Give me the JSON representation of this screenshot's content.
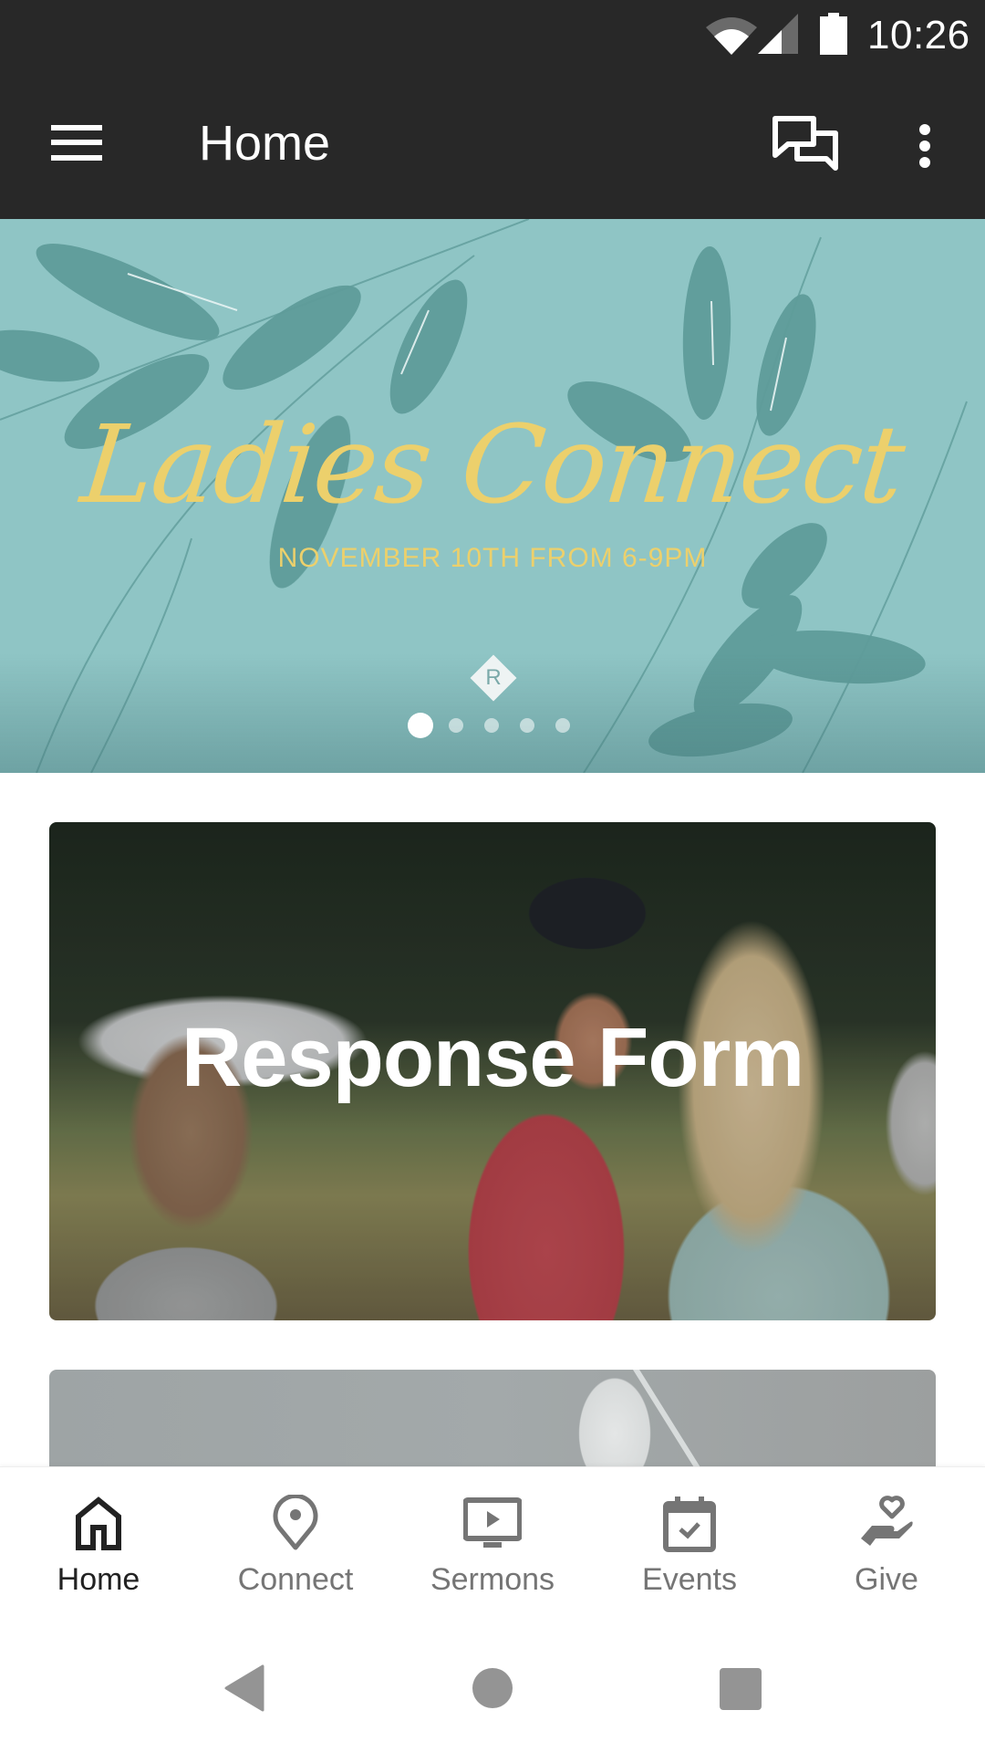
{
  "status_bar": {
    "time": "10:26",
    "icons": [
      "wifi-icon",
      "cell-signal-icon",
      "battery-icon"
    ]
  },
  "app_bar": {
    "title": "Home",
    "left_icon": "menu-icon",
    "right_icons": [
      "chat-icon",
      "more-vert-icon"
    ]
  },
  "banner": {
    "headline": "Ladies Connect",
    "subline": "NOVEMBER 10TH FROM 6-9PM",
    "logo_letter": "R",
    "slide_count": 5,
    "active_slide": 1,
    "colors": {
      "background": "#8fc5c5",
      "leaf": "#5f9c9a",
      "text": "#ecd06c"
    }
  },
  "cards": [
    {
      "title": "Response Form"
    },
    {
      "title": ""
    }
  ],
  "bottom_nav": {
    "items": [
      {
        "label": "Home",
        "icon": "home-icon",
        "active": true
      },
      {
        "label": "Connect",
        "icon": "location-pin-icon",
        "active": false
      },
      {
        "label": "Sermons",
        "icon": "video-play-icon",
        "active": false
      },
      {
        "label": "Events",
        "icon": "calendar-check-icon",
        "active": false
      },
      {
        "label": "Give",
        "icon": "hand-heart-icon",
        "active": false
      }
    ],
    "colors": {
      "active": "#222222",
      "inactive": "#757575"
    }
  },
  "system_nav": {
    "buttons": [
      "back-icon",
      "home-circle-icon",
      "recents-icon"
    ]
  }
}
